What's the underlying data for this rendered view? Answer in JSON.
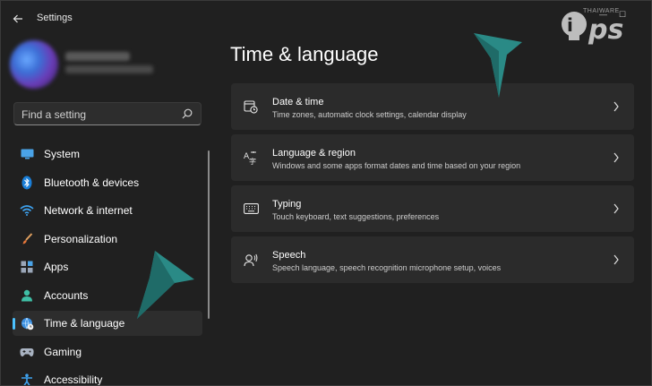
{
  "window": {
    "title": "Settings",
    "watermark_text": "THAIWARE"
  },
  "search": {
    "placeholder": "Find a setting"
  },
  "sidebar": {
    "items": [
      {
        "label": "System",
        "icon": "monitor-icon",
        "selected": false
      },
      {
        "label": "Bluetooth & devices",
        "icon": "bluetooth-icon",
        "selected": false
      },
      {
        "label": "Network & internet",
        "icon": "wifi-icon",
        "selected": false
      },
      {
        "label": "Personalization",
        "icon": "brush-icon",
        "selected": false
      },
      {
        "label": "Apps",
        "icon": "apps-icon",
        "selected": false
      },
      {
        "label": "Accounts",
        "icon": "person-icon",
        "selected": false
      },
      {
        "label": "Time & language",
        "icon": "globe-clock-icon",
        "selected": true
      },
      {
        "label": "Gaming",
        "icon": "gamepad-icon",
        "selected": false
      },
      {
        "label": "Accessibility",
        "icon": "accessibility-icon",
        "selected": false
      }
    ]
  },
  "main": {
    "title": "Time & language",
    "cards": [
      {
        "title": "Date & time",
        "description": "Time zones, automatic clock settings, calendar display",
        "icon": "calendar-clock-icon"
      },
      {
        "title": "Language & region",
        "description": "Windows and some apps format dates and time based on your region",
        "icon": "language-icon"
      },
      {
        "title": "Typing",
        "description": "Touch keyboard, text suggestions, preferences",
        "icon": "keyboard-icon"
      },
      {
        "title": "Speech",
        "description": "Speech language, speech recognition microphone setup, voices",
        "icon": "speech-icon"
      }
    ]
  },
  "colors": {
    "accent": "#4cc2ff",
    "background": "#202020",
    "card": "#2b2b2b",
    "annotation_arrow": "#2a7d7a"
  }
}
